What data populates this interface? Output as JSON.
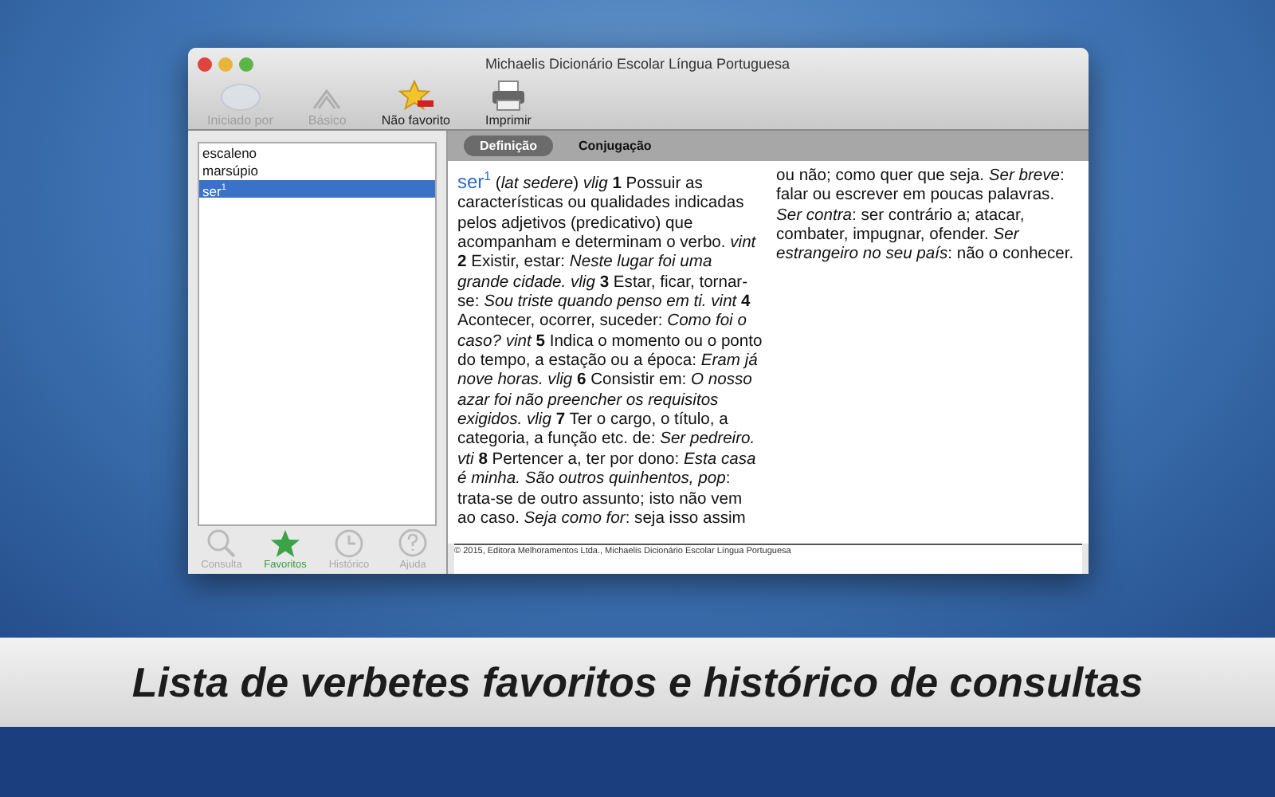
{
  "window": {
    "title": "Michaelis Dicionário Escolar Língua Portuguesa"
  },
  "toolbar": [
    {
      "kind": "abc",
      "label": "Iniciado por",
      "disabled": true
    },
    {
      "kind": "chevron",
      "label": "Básico",
      "disabled": true
    },
    {
      "kind": "unfavorite",
      "label": "Não favorito",
      "disabled": false
    },
    {
      "kind": "printer",
      "label": "Imprimir",
      "disabled": false
    }
  ],
  "sidebar": {
    "items": [
      {
        "label": "escaleno",
        "selected": false
      },
      {
        "label": "marsúpio",
        "selected": false
      },
      {
        "label": "ser$^{1}$",
        "selected": true
      }
    ],
    "tabs": [
      {
        "kind": "search",
        "label": "Consulta",
        "selected": false
      },
      {
        "kind": "star",
        "label": "Favoritos",
        "selected": true
      },
      {
        "kind": "clock",
        "label": "Histórico",
        "selected": false
      },
      {
        "kind": "help",
        "label": "Ajuda",
        "selected": false
      }
    ]
  },
  "content": {
    "tabs": [
      {
        "label": "Definição",
        "selected": true
      },
      {
        "label": "Conjugação",
        "selected": false
      }
    ],
    "headword": "ser$^{1}$",
    "definition": "(*lat sedere*) *vlig* **1** Possuir as características ou qualidades indicadas pelos adjetivos (predicativo) que acompanham e determinam o verbo. *vint* **2** Existir, estar: *Neste lugar foi uma grande cidade. vlig* **3** Estar, ficar, tornar-se: *Sou triste quando penso em ti. vint* **4** Acontecer, ocorrer, suceder: *Como foi o caso? vint* **5** Indica o momento ou o ponto do tempo, a estação ou a época: *Eram já nove horas. vlig* **6** Consistir em: *O nosso azar foi não preencher os requisitos exigidos. vlig* **7** Ter o cargo, o título, a categoria, a função etc. de: *Ser pedreiro. vti* **8** Pertencer a, ter por dono: *Esta casa é minha. São outros quinhentos, pop*: trata-se de outro assunto; isto não vem ao caso. *Seja como for*: seja isso assim ou não; como quer que seja. *Ser breve*: falar ou escrever em poucas palavras. *Ser contra*: ser contrário a; atacar, combater, impugnar, ofender. *Ser estrangeiro no seu país*: não o conhecer.",
    "footer": "© 2015, Editora Melhoramentos Ltda., Michaelis Dicionário Escolar Língua Portuguesa"
  },
  "caption": "Lista de verbetes favoritos e histórico de consultas"
}
